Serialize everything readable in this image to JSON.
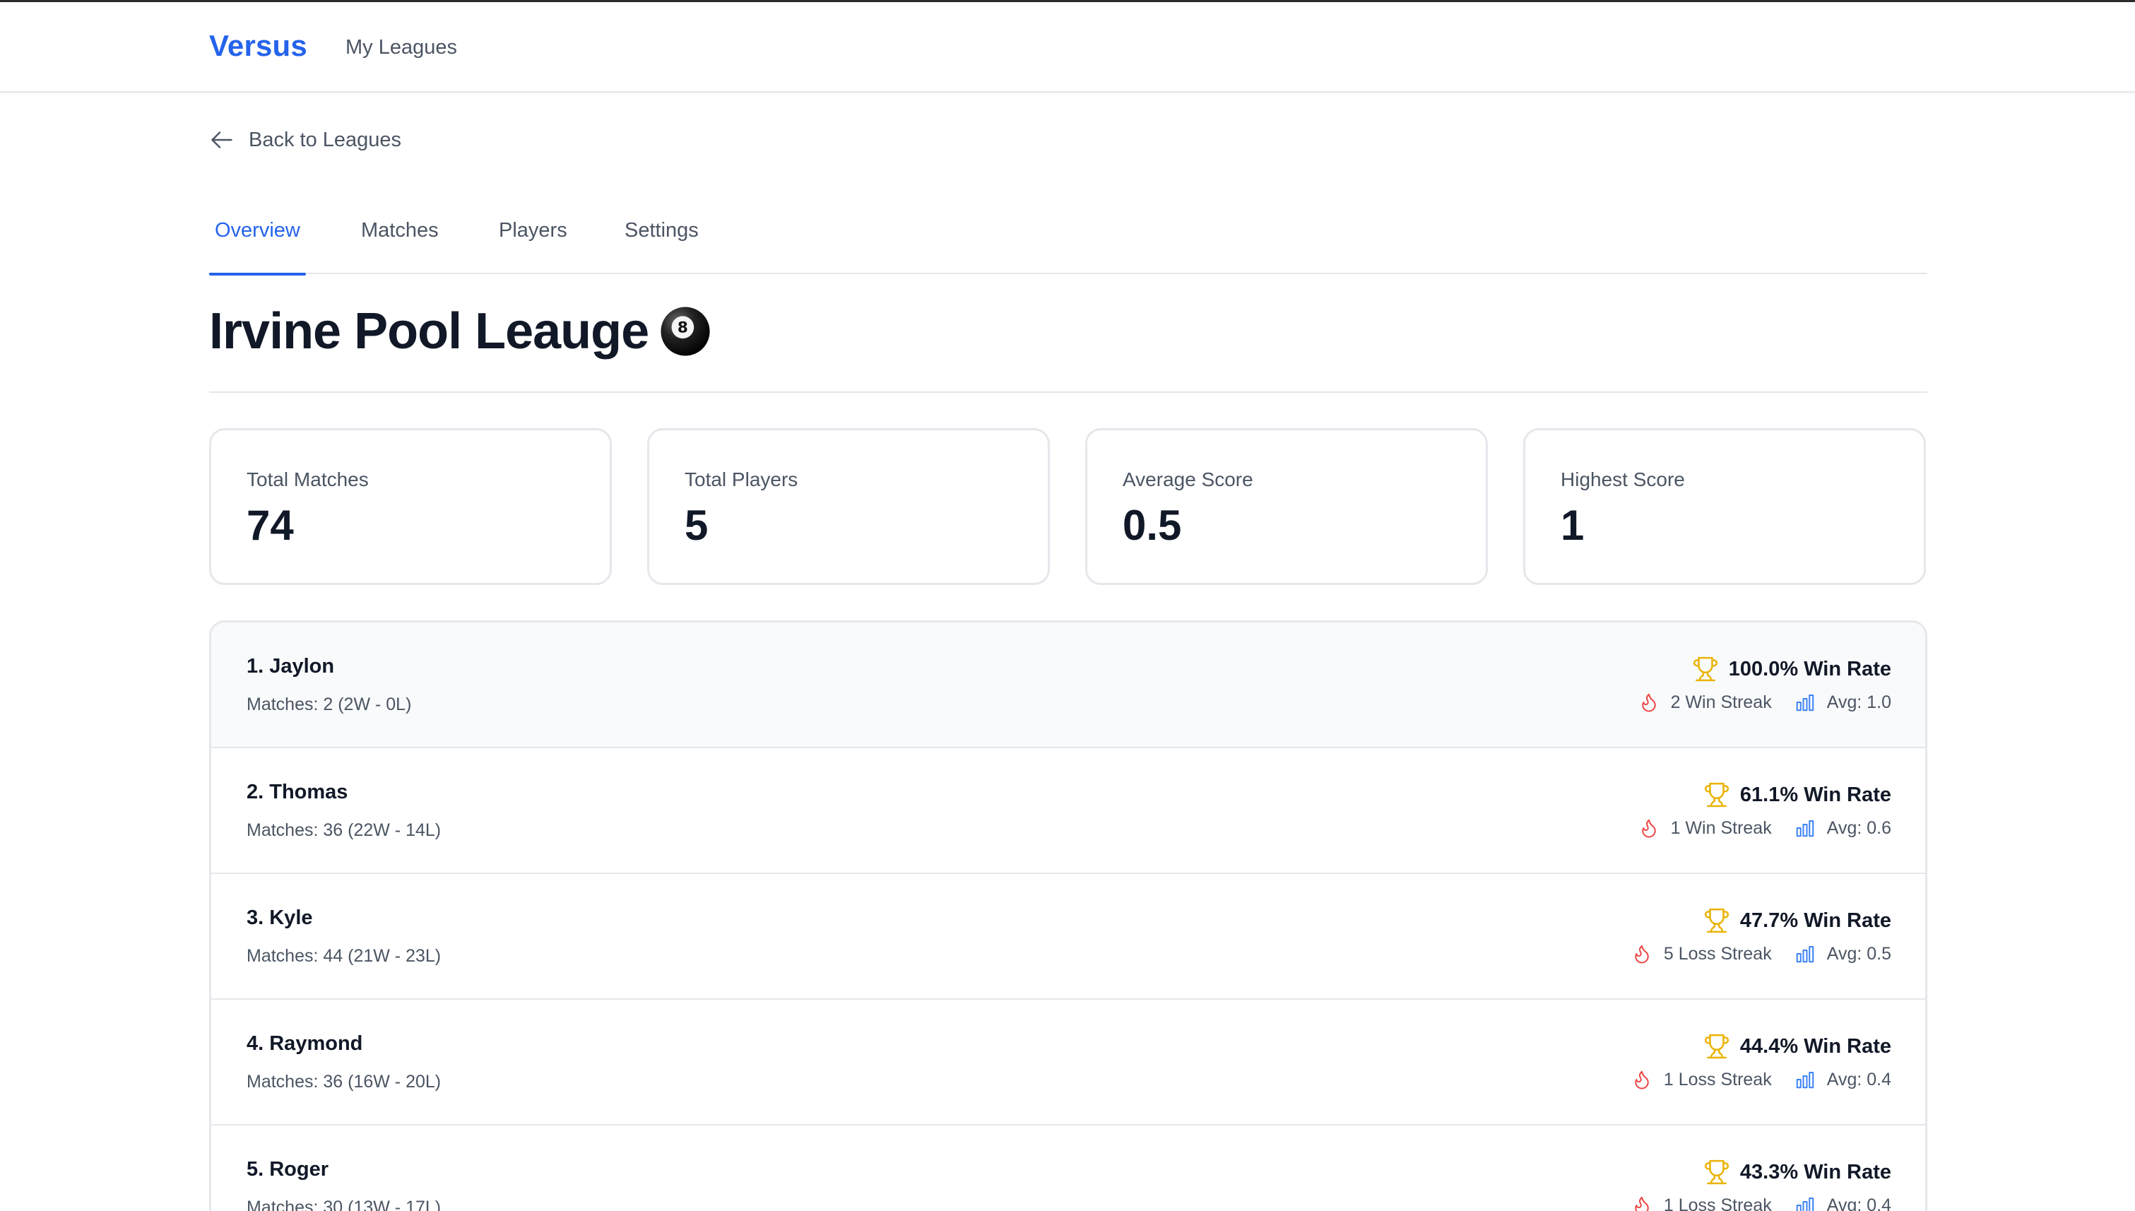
{
  "header": {
    "brand": "Versus",
    "nav_link": "My Leagues"
  },
  "back_link": "Back to Leagues",
  "tabs": [
    {
      "label": "Overview",
      "active": true
    },
    {
      "label": "Matches",
      "active": false
    },
    {
      "label": "Players",
      "active": false
    },
    {
      "label": "Settings",
      "active": false
    }
  ],
  "league": {
    "title": "Irvine Pool Leauge",
    "emoji_icon": "eight-ball-icon"
  },
  "stats": [
    {
      "label": "Total Matches",
      "value": "74"
    },
    {
      "label": "Total Players",
      "value": "5"
    },
    {
      "label": "Average Score",
      "value": "0.5"
    },
    {
      "label": "Highest Score",
      "value": "1"
    }
  ],
  "players": [
    {
      "name": "1. Jaylon",
      "matches": "Matches: 2 (2W - 0L)",
      "win_rate": "100.0% Win Rate",
      "streak": "2 Win Streak",
      "avg": "Avg: 1.0"
    },
    {
      "name": "2. Thomas",
      "matches": "Matches: 36 (22W - 14L)",
      "win_rate": "61.1% Win Rate",
      "streak": "1 Win Streak",
      "avg": "Avg: 0.6"
    },
    {
      "name": "3. Kyle",
      "matches": "Matches: 44 (21W - 23L)",
      "win_rate": "47.7% Win Rate",
      "streak": "5 Loss Streak",
      "avg": "Avg: 0.5"
    },
    {
      "name": "4. Raymond",
      "matches": "Matches: 36 (16W - 20L)",
      "win_rate": "44.4% Win Rate",
      "streak": "1 Loss Streak",
      "avg": "Avg: 0.4"
    },
    {
      "name": "5. Roger",
      "matches": "Matches: 30 (13W - 17L)",
      "win_rate": "43.3% Win Rate",
      "streak": "1 Loss Streak",
      "avg": "Avg: 0.4"
    }
  ],
  "colors": {
    "brand": "#2563eb",
    "trophy": "#eab308",
    "flame": "#ef4444",
    "chart": "#3b82f6"
  }
}
